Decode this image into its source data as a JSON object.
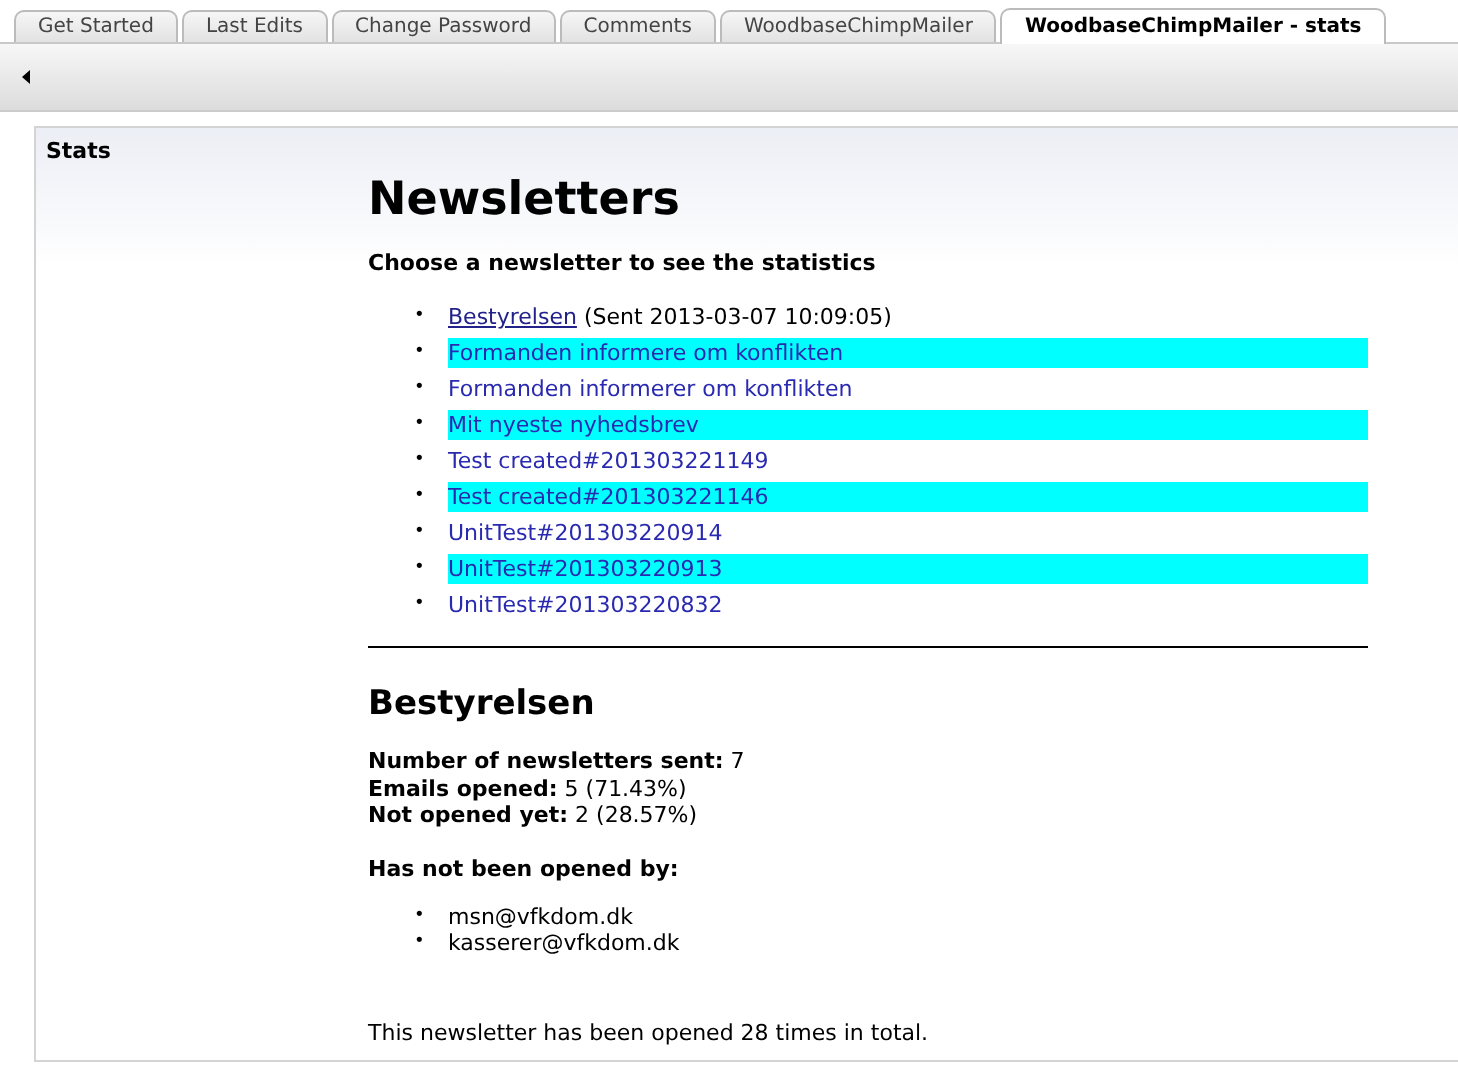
{
  "tabs": [
    {
      "label": "Get Started",
      "selected": false
    },
    {
      "label": "Last Edits",
      "selected": false
    },
    {
      "label": "Change Password",
      "selected": false
    },
    {
      "label": "Comments",
      "selected": false
    },
    {
      "label": "WoodbaseChimpMailer",
      "selected": false
    },
    {
      "label": "WoodbaseChimpMailer - stats",
      "selected": true
    }
  ],
  "panel": {
    "label": "Stats"
  },
  "page": {
    "title": "Newsletters",
    "intro": "Choose a newsletter to see the statistics",
    "bullet": "•",
    "newsletters": [
      {
        "label": "Bestyrelsen",
        "selected": true,
        "highlighted": false,
        "sent_info": "(Sent 2013-03-07 10:09:05)"
      },
      {
        "label": "Formanden informere om konflikten",
        "selected": false,
        "highlighted": true
      },
      {
        "label": "Formanden informerer om konflikten",
        "selected": false,
        "highlighted": false
      },
      {
        "label": "Mit nyeste nyhedsbrev",
        "selected": false,
        "highlighted": true
      },
      {
        "label": "Test created#201303221149",
        "selected": false,
        "highlighted": false
      },
      {
        "label": "Test created#201303221146",
        "selected": false,
        "highlighted": true
      },
      {
        "label": "UnitTest#201303220914",
        "selected": false,
        "highlighted": false
      },
      {
        "label": "UnitTest#201303220913",
        "selected": false,
        "highlighted": true
      },
      {
        "label": "UnitTest#201303220832",
        "selected": false,
        "highlighted": false
      }
    ],
    "detail": {
      "title": "Bestyrelsen",
      "stats": [
        "**Number of newsletters sent:** 7",
        "**Emails opened:** 5 (71.43%)",
        "**Not opened yet:** 2 (28.57%)"
      ],
      "unopened_heading": "Has not been opened by:",
      "unopened": [
        "msn@vfkdom.dk",
        "kasserer@vfkdom.dk"
      ],
      "total": "This newsletter has been opened 28 times in total."
    }
  }
}
